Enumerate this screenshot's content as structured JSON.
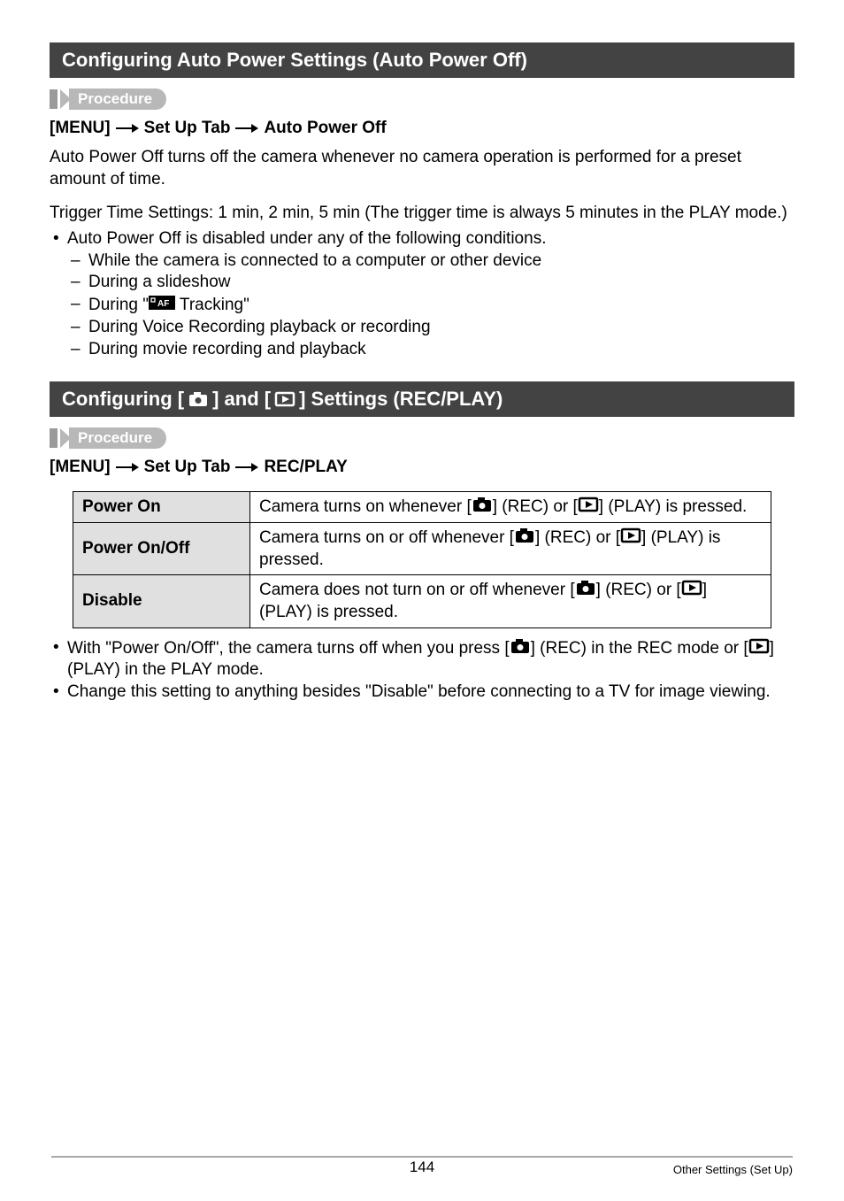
{
  "section1": {
    "title": "Configuring Auto Power Settings (Auto Power Off)",
    "procedure_label": "Procedure",
    "menu_path": {
      "menu": "[MENU]",
      "p1": "Set Up Tab",
      "p2": "Auto Power Off"
    },
    "para1": "Auto Power Off turns off the camera whenever no camera operation is performed for a preset amount of time.",
    "para2": "Trigger Time Settings: 1 min, 2 min, 5 min (The trigger time is always 5 minutes in the PLAY mode.)",
    "bullet": "Auto Power Off is disabled under any of the following conditions.",
    "dashes": {
      "d0": "While the camera is connected to a computer or other device",
      "d1": "During a slideshow",
      "d2a": "During \"",
      "d2b": " Tracking\"",
      "d3": "During Voice Recording playback or recording",
      "d4": "During movie recording and playback"
    }
  },
  "section2": {
    "title_a": "Configuring [",
    "title_b": "] and [",
    "title_c": "] Settings (REC/PLAY)",
    "procedure_label": "Procedure",
    "menu_path": {
      "menu": "[MENU]",
      "p1": "Set Up Tab",
      "p2": "REC/PLAY"
    },
    "table": {
      "rows": [
        {
          "label": "Power On",
          "pre": "Camera turns on whenever [",
          "mid": "] (REC) or [",
          "post": "] (PLAY) is pressed."
        },
        {
          "label": "Power On/Off",
          "pre": "Camera turns on or off whenever [",
          "mid": "] (REC) or [",
          "post": "] (PLAY) is pressed."
        },
        {
          "label": "Disable",
          "pre": "Camera does not turn on or off whenever [",
          "mid": "] (REC) or [",
          "post": "] (PLAY) is pressed."
        }
      ]
    },
    "notes": {
      "n0a": "With \"Power On/Off\", the camera turns off when you press [",
      "n0b": "] (REC) in the REC mode or [",
      "n0c": "] (PLAY) in the PLAY mode.",
      "n1": "Change this setting to anything besides \"Disable\" before connecting to a TV for image viewing."
    }
  },
  "footer": {
    "page": "144",
    "section": "Other Settings (Set Up)"
  }
}
